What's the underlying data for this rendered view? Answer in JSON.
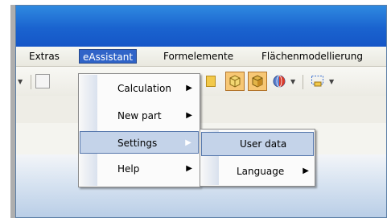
{
  "menubar": {
    "items": [
      {
        "label": "Extras"
      },
      {
        "label": "eAssistant"
      },
      {
        "label": "Formelemente"
      },
      {
        "label": "Flächenmodellierung"
      }
    ]
  },
  "eassistant_menu": {
    "items": [
      {
        "label": "Calculation",
        "submenu_arrow": "▶"
      },
      {
        "label": "New part",
        "submenu_arrow": "▶"
      },
      {
        "label": "Settings",
        "submenu_arrow": "▶"
      },
      {
        "label": "Help",
        "submenu_arrow": "▶"
      }
    ]
  },
  "settings_submenu": {
    "items": [
      {
        "label": "User data"
      },
      {
        "label": "Language",
        "submenu_arrow": "▶"
      }
    ]
  },
  "colors": {
    "titlebar": "#1a63cf",
    "menu_highlight": "#c4d3e9",
    "active_menu": "#3064c8",
    "pressed_button": "#f7c774"
  }
}
